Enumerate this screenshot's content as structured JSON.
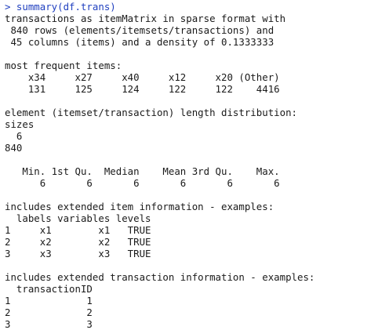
{
  "console": {
    "lines": [
      {
        "kind": "cmd",
        "text": "> summary(df.trans)"
      },
      {
        "kind": "out",
        "text": "transactions as itemMatrix in sparse format with"
      },
      {
        "kind": "out",
        "text": " 840 rows (elements/itemsets/transactions) and"
      },
      {
        "kind": "out",
        "text": " 45 columns (items) and a density of 0.1333333"
      },
      {
        "kind": "out",
        "text": ""
      },
      {
        "kind": "out",
        "text": "most frequent items:"
      },
      {
        "kind": "out",
        "text": "    x34     x27     x40     x12     x20 (Other)"
      },
      {
        "kind": "out",
        "text": "    131     125     124     122     122    4416"
      },
      {
        "kind": "out",
        "text": ""
      },
      {
        "kind": "out",
        "text": "element (itemset/transaction) length distribution:"
      },
      {
        "kind": "out",
        "text": "sizes"
      },
      {
        "kind": "out",
        "text": "  6"
      },
      {
        "kind": "out",
        "text": "840"
      },
      {
        "kind": "out",
        "text": ""
      },
      {
        "kind": "out",
        "text": "   Min. 1st Qu.  Median    Mean 3rd Qu.    Max."
      },
      {
        "kind": "out",
        "text": "      6       6       6       6       6       6"
      },
      {
        "kind": "out",
        "text": ""
      },
      {
        "kind": "out",
        "text": "includes extended item information - examples:"
      },
      {
        "kind": "out",
        "text": "  labels variables levels"
      },
      {
        "kind": "out",
        "text": "1     x1        x1   TRUE"
      },
      {
        "kind": "out",
        "text": "2     x2        x2   TRUE"
      },
      {
        "kind": "out",
        "text": "3     x3        x3   TRUE"
      },
      {
        "kind": "out",
        "text": ""
      },
      {
        "kind": "out",
        "text": "includes extended transaction information - examples:"
      },
      {
        "kind": "out",
        "text": "  transactionID"
      },
      {
        "kind": "out",
        "text": "1             1"
      },
      {
        "kind": "out",
        "text": "2             2"
      },
      {
        "kind": "out",
        "text": "3             3"
      }
    ]
  }
}
